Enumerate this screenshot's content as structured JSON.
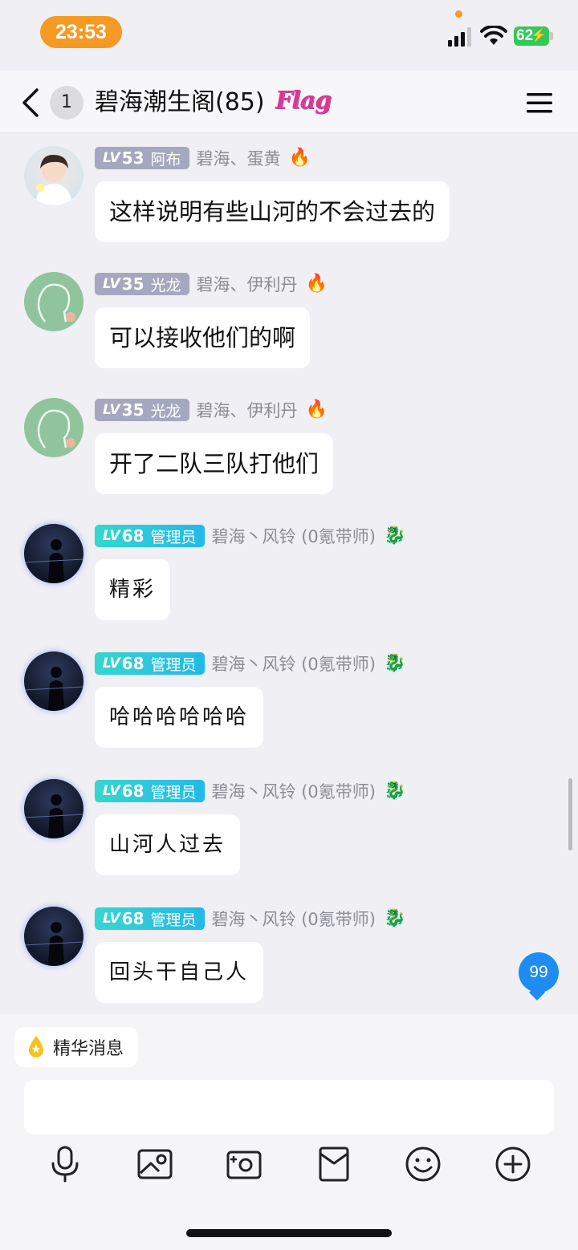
{
  "status_bar": {
    "time": "23:53",
    "battery": "62"
  },
  "header": {
    "unread_count": "1",
    "title": "碧海潮生阁(85)",
    "badge": "Flag"
  },
  "messages": [
    {
      "level_prefix": "LV",
      "level": "53",
      "role": "阿布",
      "name": "碧海、蛋黄",
      "title_icon": "fire-icon",
      "text": "这样说明有些山河的不会过去的",
      "avatar": "cartoon-boy-avatar"
    },
    {
      "level_prefix": "LV",
      "level": "35",
      "role": "光龙",
      "name": "碧海、伊利丹",
      "title_icon": "fire-icon",
      "text": "可以接收他们的啊",
      "avatar": "silhouette-avatar"
    },
    {
      "level_prefix": "LV",
      "level": "35",
      "role": "光龙",
      "name": "碧海、伊利丹",
      "title_icon": "fire-icon",
      "text": "开了二队三队打他们",
      "avatar": "silhouette-avatar"
    },
    {
      "level_prefix": "LV",
      "level": "68",
      "role": "管理员",
      "name": "碧海丶风铃 (0氪带师)",
      "title_icon": "dragon-icon",
      "text": "精彩",
      "avatar": "night-figure-avatar"
    },
    {
      "level_prefix": "LV",
      "level": "68",
      "role": "管理员",
      "name": "碧海丶风铃 (0氪带师)",
      "title_icon": "dragon-icon",
      "text": "哈哈哈哈哈哈",
      "avatar": "night-figure-avatar"
    },
    {
      "level_prefix": "LV",
      "level": "68",
      "role": "管理员",
      "name": "碧海丶风铃 (0氪带师)",
      "title_icon": "dragon-icon",
      "text": "山河人过去",
      "avatar": "night-figure-avatar"
    },
    {
      "level_prefix": "LV",
      "level": "68",
      "role": "管理员",
      "name": "碧海丶风铃 (0氪带师)",
      "title_icon": "dragon-icon",
      "text": "回头干自己人",
      "avatar": "night-figure-avatar"
    }
  ],
  "unread_bubble": "99",
  "essence_label": "精华消息",
  "input": {
    "value": "",
    "placeholder": ""
  },
  "toolbar": [
    "microphone-icon",
    "image-icon",
    "camera-icon",
    "red-packet-icon",
    "emoji-icon",
    "plus-icon"
  ],
  "colors": {
    "time_pill": "#f59a23",
    "battery": "#34c759",
    "admin_badge": "#2ac9de",
    "member_badge": "#a4a8bf",
    "unread_bubble": "#1e8cf0"
  }
}
